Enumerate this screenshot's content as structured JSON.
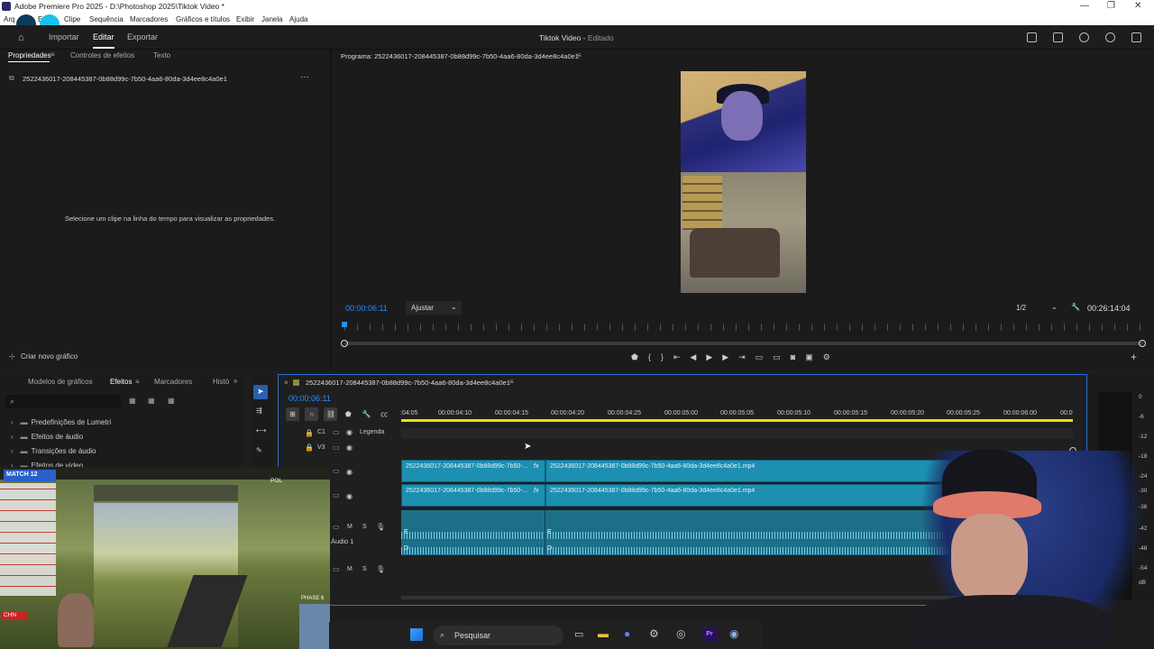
{
  "window": {
    "title": "Adobe Premiere Pro 2025 - D:\\Photoshop 2025\\Tiktok Video *",
    "controls": [
      "—",
      "❐",
      "✕"
    ]
  },
  "menu": [
    "Arquivo",
    "Editar",
    "Clipe",
    "Sequência",
    "Marcadores",
    "Gráficos e títulos",
    "Exibir",
    "Janela",
    "Ajuda"
  ],
  "menu_partial": {
    "arq": "Arq",
    "editar": "Ed",
    "clipe": "Clipe"
  },
  "header": {
    "nav_import": "Importar",
    "nav_edit": "Editar",
    "nav_export": "Exportar",
    "doc_title": "Tiktok Video",
    "doc_state": "Editado"
  },
  "properties": {
    "tabs": [
      "Propriedades",
      "Controles de efeitos",
      "Texto"
    ],
    "clip_name": "2522436017-208445387-0b88d99c-7b50-4aa6-80da-3d4ee8c4a0e1",
    "empty_message": "Selecione um clipe na linha do tempo para visualizar as propriedades.",
    "new_graphic": "Criar novo gráfico"
  },
  "program": {
    "title": "Programa: 2522436017-208445387-0b88d99c-7b50-4aa6-80da-3d4ee8c4a0e1",
    "timecode": "00:00:06:11",
    "fit_label": "Ajustar",
    "resolution": "1/2",
    "duration": "00:26:14:04",
    "playhead_fraction": 0.0
  },
  "effects_panel": {
    "tabs": [
      "Modelos de gráficos",
      "Efeitos",
      "Marcadores",
      "Histó"
    ],
    "items": [
      "Predefinições de Lumetri",
      "Efeitos de áudio",
      "Transições de áudio",
      "Efeitos de vídeo"
    ]
  },
  "sequence": {
    "tab_name": "2522436017-208445387-0b88d99c-7b50-4aa6-80da-3d4ee8c4a0e1",
    "timecode": "00:00:06:11",
    "ruler": [
      ":04:05",
      "00:00:04:10",
      "00:00:04:15",
      "00:00:04:20",
      "00:00:04:25",
      "00:00:05:00",
      "00:00:05:05",
      "00:00:05:10",
      "00:00:05:15",
      "00:00:05:20",
      "00:00:05:25",
      "00:00:06:00",
      "00:0"
    ],
    "caption_track": "C1",
    "caption_label": "Legenda",
    "v3": "V3",
    "audio_track_name": "Áudio 1",
    "clip_short": "2522436017-208445387-0b88d99c-7b50-...",
    "clip_full": "2522436017-208445387-0b88d99c-7b50-4aa6-80da-3d4ee8c4a0e1.mp4",
    "fx": "fx",
    "mute": "M",
    "solo": "S",
    "audio_markers": [
      "E",
      "D"
    ]
  },
  "meter": {
    "scale": [
      "0",
      "-6",
      "-12",
      "-18",
      "-24",
      "-30",
      "-36",
      "-42",
      "-48",
      "-54",
      "dB"
    ]
  },
  "taskbar": {
    "search": "Pesquisar"
  },
  "overlay_game": {
    "banner": "MATCH 12",
    "tag1": "CHN",
    "tag2": "POL",
    "phase": "PHASE 6"
  },
  "colors": {
    "accent_blue": "#2a8cff",
    "clip_video": "#1d8fb0",
    "clip_audio": "#1d6f88",
    "work_area": "#e6e600"
  }
}
